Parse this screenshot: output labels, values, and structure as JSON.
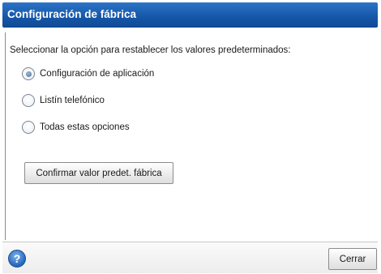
{
  "dialog": {
    "title": "Configuración de fábrica",
    "instruction": "Seleccionar la opción para restablecer los valores predeterminados:",
    "options": [
      {
        "label": "Configuración de aplicación",
        "selected": true
      },
      {
        "label": "Listín telefónico",
        "selected": false
      },
      {
        "label": "Todas estas opciones",
        "selected": false
      }
    ],
    "confirm_label": "Confirmar valor predet. fábrica"
  },
  "footer": {
    "help_symbol": "?",
    "help_icon": "question-mark-icon",
    "close_label": "Cerrar"
  },
  "colors": {
    "titlebar": "#1456a8",
    "title_text": "#ffffff",
    "help_button": "#2566b8"
  }
}
